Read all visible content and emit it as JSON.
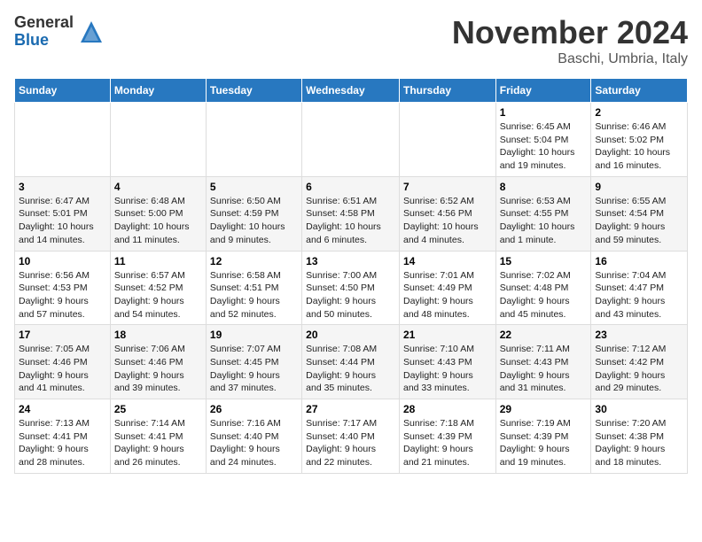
{
  "header": {
    "logo_line1": "General",
    "logo_line2": "Blue",
    "month": "November 2024",
    "location": "Baschi, Umbria, Italy"
  },
  "weekdays": [
    "Sunday",
    "Monday",
    "Tuesday",
    "Wednesday",
    "Thursday",
    "Friday",
    "Saturday"
  ],
  "weeks": [
    [
      {
        "day": "",
        "info": ""
      },
      {
        "day": "",
        "info": ""
      },
      {
        "day": "",
        "info": ""
      },
      {
        "day": "",
        "info": ""
      },
      {
        "day": "",
        "info": ""
      },
      {
        "day": "1",
        "info": "Sunrise: 6:45 AM\nSunset: 5:04 PM\nDaylight: 10 hours\nand 19 minutes."
      },
      {
        "day": "2",
        "info": "Sunrise: 6:46 AM\nSunset: 5:02 PM\nDaylight: 10 hours\nand 16 minutes."
      }
    ],
    [
      {
        "day": "3",
        "info": "Sunrise: 6:47 AM\nSunset: 5:01 PM\nDaylight: 10 hours\nand 14 minutes."
      },
      {
        "day": "4",
        "info": "Sunrise: 6:48 AM\nSunset: 5:00 PM\nDaylight: 10 hours\nand 11 minutes."
      },
      {
        "day": "5",
        "info": "Sunrise: 6:50 AM\nSunset: 4:59 PM\nDaylight: 10 hours\nand 9 minutes."
      },
      {
        "day": "6",
        "info": "Sunrise: 6:51 AM\nSunset: 4:58 PM\nDaylight: 10 hours\nand 6 minutes."
      },
      {
        "day": "7",
        "info": "Sunrise: 6:52 AM\nSunset: 4:56 PM\nDaylight: 10 hours\nand 4 minutes."
      },
      {
        "day": "8",
        "info": "Sunrise: 6:53 AM\nSunset: 4:55 PM\nDaylight: 10 hours\nand 1 minute."
      },
      {
        "day": "9",
        "info": "Sunrise: 6:55 AM\nSunset: 4:54 PM\nDaylight: 9 hours\nand 59 minutes."
      }
    ],
    [
      {
        "day": "10",
        "info": "Sunrise: 6:56 AM\nSunset: 4:53 PM\nDaylight: 9 hours\nand 57 minutes."
      },
      {
        "day": "11",
        "info": "Sunrise: 6:57 AM\nSunset: 4:52 PM\nDaylight: 9 hours\nand 54 minutes."
      },
      {
        "day": "12",
        "info": "Sunrise: 6:58 AM\nSunset: 4:51 PM\nDaylight: 9 hours\nand 52 minutes."
      },
      {
        "day": "13",
        "info": "Sunrise: 7:00 AM\nSunset: 4:50 PM\nDaylight: 9 hours\nand 50 minutes."
      },
      {
        "day": "14",
        "info": "Sunrise: 7:01 AM\nSunset: 4:49 PM\nDaylight: 9 hours\nand 48 minutes."
      },
      {
        "day": "15",
        "info": "Sunrise: 7:02 AM\nSunset: 4:48 PM\nDaylight: 9 hours\nand 45 minutes."
      },
      {
        "day": "16",
        "info": "Sunrise: 7:04 AM\nSunset: 4:47 PM\nDaylight: 9 hours\nand 43 minutes."
      }
    ],
    [
      {
        "day": "17",
        "info": "Sunrise: 7:05 AM\nSunset: 4:46 PM\nDaylight: 9 hours\nand 41 minutes."
      },
      {
        "day": "18",
        "info": "Sunrise: 7:06 AM\nSunset: 4:46 PM\nDaylight: 9 hours\nand 39 minutes."
      },
      {
        "day": "19",
        "info": "Sunrise: 7:07 AM\nSunset: 4:45 PM\nDaylight: 9 hours\nand 37 minutes."
      },
      {
        "day": "20",
        "info": "Sunrise: 7:08 AM\nSunset: 4:44 PM\nDaylight: 9 hours\nand 35 minutes."
      },
      {
        "day": "21",
        "info": "Sunrise: 7:10 AM\nSunset: 4:43 PM\nDaylight: 9 hours\nand 33 minutes."
      },
      {
        "day": "22",
        "info": "Sunrise: 7:11 AM\nSunset: 4:43 PM\nDaylight: 9 hours\nand 31 minutes."
      },
      {
        "day": "23",
        "info": "Sunrise: 7:12 AM\nSunset: 4:42 PM\nDaylight: 9 hours\nand 29 minutes."
      }
    ],
    [
      {
        "day": "24",
        "info": "Sunrise: 7:13 AM\nSunset: 4:41 PM\nDaylight: 9 hours\nand 28 minutes."
      },
      {
        "day": "25",
        "info": "Sunrise: 7:14 AM\nSunset: 4:41 PM\nDaylight: 9 hours\nand 26 minutes."
      },
      {
        "day": "26",
        "info": "Sunrise: 7:16 AM\nSunset: 4:40 PM\nDaylight: 9 hours\nand 24 minutes."
      },
      {
        "day": "27",
        "info": "Sunrise: 7:17 AM\nSunset: 4:40 PM\nDaylight: 9 hours\nand 22 minutes."
      },
      {
        "day": "28",
        "info": "Sunrise: 7:18 AM\nSunset: 4:39 PM\nDaylight: 9 hours\nand 21 minutes."
      },
      {
        "day": "29",
        "info": "Sunrise: 7:19 AM\nSunset: 4:39 PM\nDaylight: 9 hours\nand 19 minutes."
      },
      {
        "day": "30",
        "info": "Sunrise: 7:20 AM\nSunset: 4:38 PM\nDaylight: 9 hours\nand 18 minutes."
      }
    ]
  ]
}
